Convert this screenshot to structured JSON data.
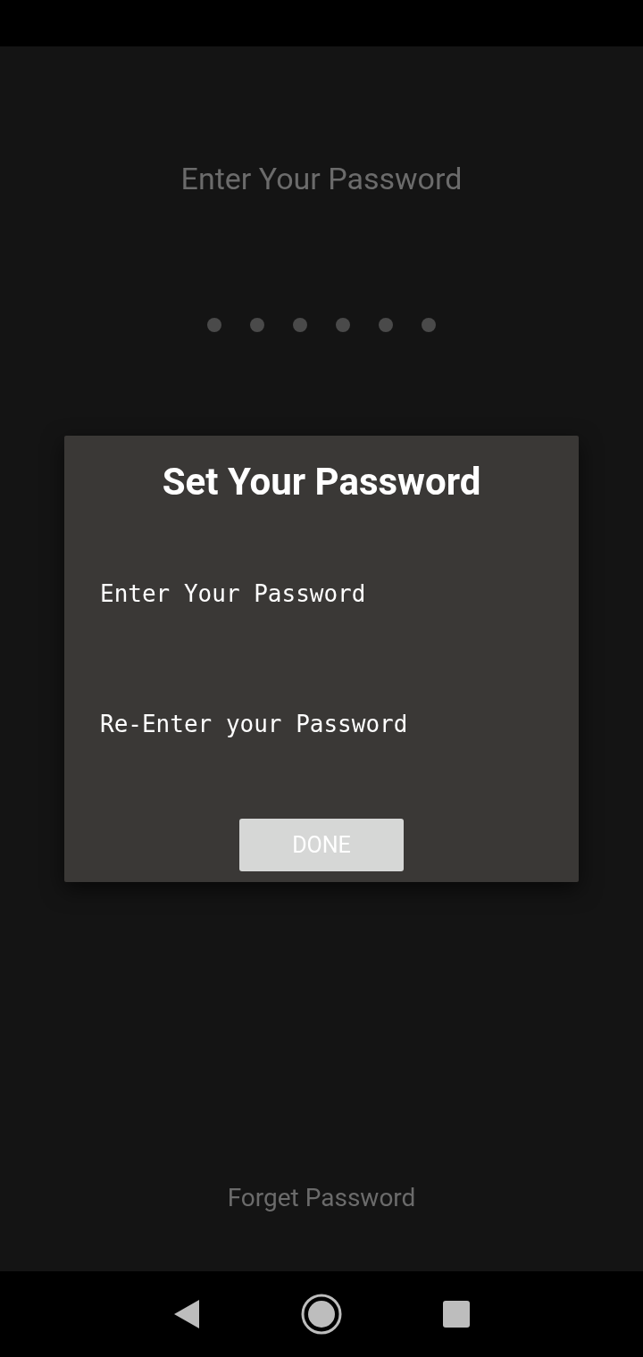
{
  "screen": {
    "title": "Enter Your Password",
    "pin_dots": [
      {
        "filled": false
      },
      {
        "filled": false
      },
      {
        "filled": false
      },
      {
        "filled": false
      },
      {
        "filled": false
      },
      {
        "filled": false
      }
    ],
    "forgot_link": "Forget Password"
  },
  "dialog": {
    "title": "Set Your Password",
    "fields": [
      {
        "placeholder": "Enter Your Password"
      },
      {
        "placeholder": "Re-Enter your Password"
      }
    ],
    "button": "DONE"
  }
}
